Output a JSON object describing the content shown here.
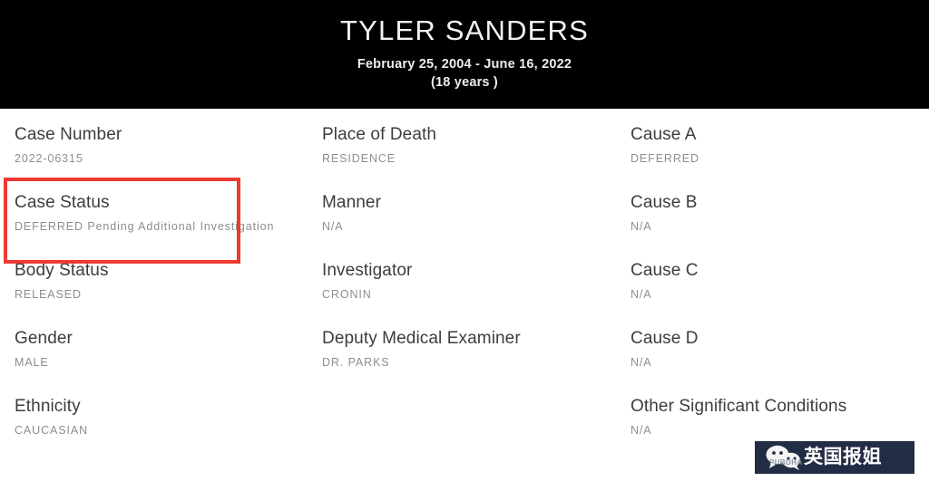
{
  "header": {
    "name": "TYLER SANDERS",
    "date_range": "February 25, 2004 - June 16, 2022",
    "age": "(18 years )",
    "background_color": "#000000",
    "text_color": "#ffffff"
  },
  "annotation": {
    "highlight_color": "#ed3a33",
    "highlighted_field": "Case Status"
  },
  "columns": {
    "left": [
      {
        "label": "Case Number",
        "value": "2022-06315"
      },
      {
        "label": "Case Status",
        "value": "DEFERRED Pending Additional Investigation"
      },
      {
        "label": "Body Status",
        "value": "RELEASED"
      },
      {
        "label": "Gender",
        "value": "MALE"
      },
      {
        "label": "Ethnicity",
        "value": "CAUCASIAN"
      }
    ],
    "middle": [
      {
        "label": "Place of Death",
        "value": "RESIDENCE"
      },
      {
        "label": "Manner",
        "value": "N/A"
      },
      {
        "label": "Investigator",
        "value": "CRONIN"
      },
      {
        "label": "Deputy Medical Examiner",
        "value": "DR. PARKS"
      }
    ],
    "right": [
      {
        "label": "Cause A",
        "value": "DEFERRED"
      },
      {
        "label": "Cause B",
        "value": "N/A"
      },
      {
        "label": "Cause C",
        "value": "N/A"
      },
      {
        "label": "Cause D",
        "value": "N/A"
      },
      {
        "label": "Other Significant Conditions",
        "value": "N/A"
      }
    ]
  },
  "watermark": {
    "text": "英国报姐",
    "subtext": "PUBDHA",
    "icon": "wechat-icon",
    "background_color": "#232c45"
  }
}
